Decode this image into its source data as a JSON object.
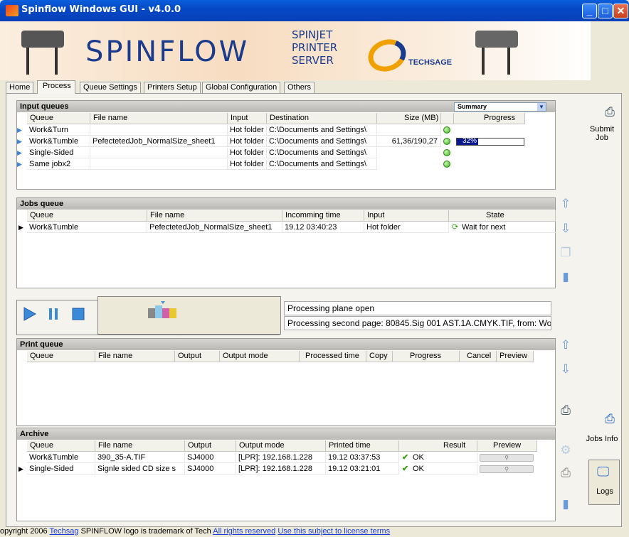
{
  "window": {
    "title": "Spinflow Windows GUI - v4.0.0"
  },
  "banner": {
    "logo_text": "SPINFLOW",
    "subtitle_lines": "SPINJET\nPRINTER\nSERVER",
    "brand_text": "TECHSAGE"
  },
  "tabs": [
    "Home",
    "Process",
    "Queue Settings",
    "Printers Setup",
    "Global Configuration",
    "Others"
  ],
  "active_tab": "Process",
  "input_queues": {
    "title": "Input queues",
    "summary_select": "Summary",
    "columns": [
      "Queue",
      "File name",
      "Input",
      "Destination",
      "Size (MB)",
      "",
      "Progress"
    ],
    "rows": [
      {
        "queue": "Work&Turn",
        "file": "",
        "input": "Hot folder",
        "dest": "C:\\Documents and Settings\\",
        "size": "",
        "progress": ""
      },
      {
        "queue": "Work&Tumble",
        "file": "PefectetedJob_NormalSize_sheet1",
        "input": "Hot folder",
        "dest": "C:\\Documents and Settings\\",
        "size": "61,36/190,27",
        "progress": "32%"
      },
      {
        "queue": "Single-Sided",
        "file": "",
        "input": "Hot folder",
        "dest": "C:\\Documents and Settings\\",
        "size": "",
        "progress": ""
      },
      {
        "queue": "Same jobx2",
        "file": "",
        "input": "Hot folder",
        "dest": "C:\\Documents and Settings\\",
        "size": "",
        "progress": ""
      }
    ],
    "progress_fraction": 0.32
  },
  "jobs_queue": {
    "title": "Jobs queue",
    "columns": [
      "Queue",
      "File name",
      "Incomming time",
      "Input",
      "State"
    ],
    "rows": [
      {
        "queue": "Work&Tumble",
        "file": "PefectetedJob_NormalSize_sheet1",
        "time": "19.12 03:40:23",
        "input": "Hot folder",
        "state": "Wait for next"
      }
    ]
  },
  "status": {
    "line1": "Processing plane open",
    "line2": "Processing second page: 80845.Sig 001 AST.1A.CMYK.TIF, from: Wor"
  },
  "print_queue": {
    "title": "Print queue",
    "columns": [
      "Queue",
      "File name",
      "Output",
      "Output mode",
      "Processed time",
      "Copy",
      "Progress",
      "Cancel",
      "Preview"
    ]
  },
  "archive": {
    "title": "Archive",
    "columns": [
      "Queue",
      "File name",
      "Output",
      "Output mode",
      "Printed time",
      "Result",
      "Preview"
    ],
    "rows": [
      {
        "queue": "Work&Tumble",
        "file": "390_35-A.TIF",
        "output": "SJ4000",
        "mode": "[LPR]: 192.168.1.228",
        "time": "19.12 03:37:53",
        "result": "OK"
      },
      {
        "queue": "Single-Sided",
        "file": "Signle sided CD size s",
        "output": "SJ4000",
        "mode": "[LPR]: 192.168.1.228",
        "time": "19.12 03:21:01",
        "result": "OK"
      }
    ]
  },
  "side": {
    "submit_job": "Submit Job",
    "jobs_info": "Jobs Info",
    "logs": "Logs"
  },
  "footer": {
    "text1": "opyright 2006",
    "link1": "Techsag",
    "text2": "SPINFLOW logo is trademark of Tech",
    "link2": "All rights reserved",
    "link3": "Use this subject to license terms"
  },
  "colors": {
    "title_bar": "#0549c6",
    "brand_blue": "#1b3c8c",
    "progress_fill": "#0a1a8c",
    "ok_green": "#38b018"
  }
}
